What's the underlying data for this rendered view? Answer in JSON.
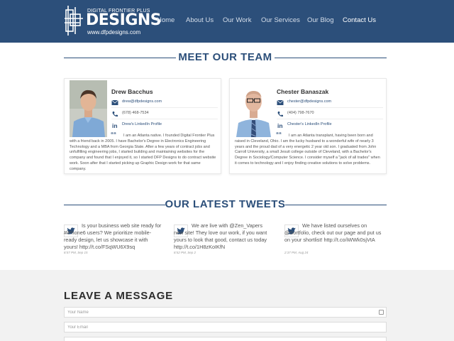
{
  "header": {
    "logo": {
      "top_text": "DIGITAL FRONTIER PLUS",
      "main_text": "DESIGNS",
      "url": "www.dfpdesigns.com"
    },
    "nav": [
      {
        "label": "Home",
        "active": false
      },
      {
        "label": "About Us",
        "active": false
      },
      {
        "label": "Our Work",
        "active": false
      },
      {
        "label": "Our Services",
        "active": false
      },
      {
        "label": "Our Blog",
        "active": false
      },
      {
        "label": "Contact Us",
        "active": true
      }
    ]
  },
  "team": {
    "title": "MEET OUR TEAM",
    "members": [
      {
        "name": "Drew Bacchus",
        "email": "drew@dfpdesigns.com",
        "phone": "(678) 468-7534",
        "linkedin": "Drew's LinkedIn Profile",
        "bio": "I am an Atlanta native. I founded Digital Frontier Plus with a friend back in 2005. I have Bachelor's Degree in Electronics Engineering Technology and a MBA from Georgia State. After a few years of contract jobs and unfulfilling engineering jobs, I started building and maintaining websites for the company and found that I enjoyed it, so I started DFP Designs to do contract website work. Soon after that I started picking up Graphic Design work for that same company."
      },
      {
        "name": "Chester Banaszak",
        "email": "chester@dfpdesigns.com",
        "phone": "(404) 798-7670",
        "linkedin": "Chester's LinkedIn Profile",
        "bio": "I am an Atlanta transplant, having been born and raised in Cleveland, Ohio. I am the lucky husband to a wonderful wife of nearly 3 years and the proud dad of a very energetic 2 year old son. I graduated from John Carroll University, a small Jesuit college outside of Cleveland, with a Bachelor's Degree in Sociology/Computer Science. I consider myself a \"jack of all trades\" when it comes to technology and I enjoy finding creative solutions to solve problems."
      }
    ]
  },
  "tweets": {
    "title": "OUR LATEST TWEETS",
    "items": [
      {
        "text": "Is your business web site ready for #iPhone6 users? We prioritize mobile-ready design, let us showcase it with yours! http://t.co/FSqWU6X9sq",
        "time": "8:57 PM, Sep 15"
      },
      {
        "text": "We are live with @Zen_Vapers new site! They love our work, if you want yours to look that good, contact us today http://t.co/1H8zKoIKfN",
        "time": "8:52 PM, Sep 2"
      },
      {
        "text": "We have listed ourselves on @Sortfolio, check out our page and put us on your shortlist! http://t.co/iWWk0sjVtA",
        "time": "2:37 PM, Aug 24"
      }
    ]
  },
  "message": {
    "title": "LEAVE A MESSAGE",
    "name_placeholder": "Your Name",
    "email_placeholder": "Your Email"
  },
  "colors": {
    "brand": "#2c4f7a",
    "background_message": "#f2f2f2"
  },
  "icons": {
    "email": "envelope-icon",
    "phone": "phone-icon",
    "linkedin": "linkedin-icon",
    "quote": "quote-icon",
    "twitter": "twitter-bird-icon"
  }
}
